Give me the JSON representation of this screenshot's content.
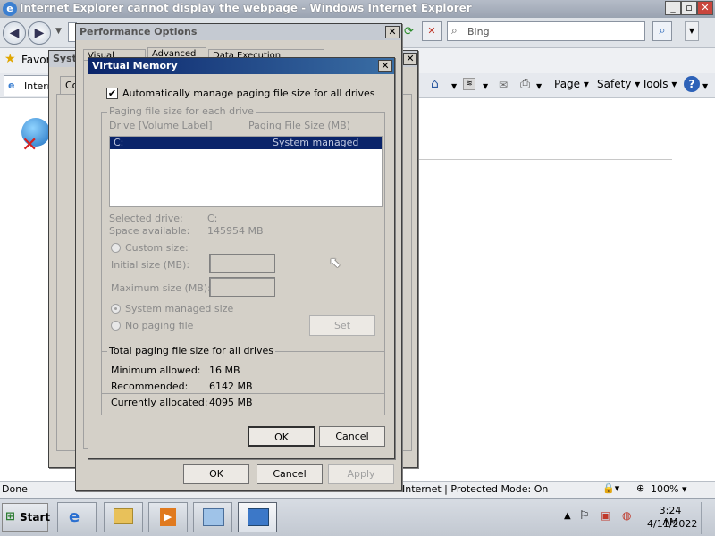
{
  "ie": {
    "title": "Internet Explorer cannot display the webpage - Windows Internet Explorer",
    "search_placeholder": "Bing",
    "favorites_label": "Favori",
    "tab_label": "Intern",
    "commands": [
      "Page",
      "Safety",
      "Tools"
    ],
    "status_left": "Done",
    "status_zone": "Internet | Protected Mode: On",
    "zoom": "100%"
  },
  "background_dialogs": {
    "system_label": "Syst",
    "sysprops_tab": "Co"
  },
  "perf": {
    "title": "Performance Options",
    "tabs": [
      "Visual Effects",
      "Advanced",
      "Data Execution Prevention"
    ],
    "ok": "OK",
    "cancel": "Cancel",
    "apply": "Apply"
  },
  "vm": {
    "title": "Virtual Memory",
    "auto_manage_label": "Automatically manage paging file size for all drives",
    "auto_manage_checked": true,
    "each_drive_group": "Paging file size for each drive",
    "col_drive": "Drive  [Volume Label]",
    "col_size": "Paging File Size (MB)",
    "drives": [
      {
        "drive": "C:",
        "size": "System managed"
      }
    ],
    "selected_drive_label": "Selected drive:",
    "selected_drive_value": "C:",
    "space_available_label": "Space available:",
    "space_available_value": "145954 MB",
    "custom_size_label": "Custom size:",
    "initial_size_label": "Initial size (MB):",
    "maximum_size_label": "Maximum size (MB):",
    "system_managed_label": "System managed size",
    "no_paging_label": "No paging file",
    "set_button": "Set",
    "total_group": "Total paging file size for all drives",
    "minimum_label": "Minimum allowed:",
    "minimum_value": "16 MB",
    "recommended_label": "Recommended:",
    "recommended_value": "6142 MB",
    "allocated_label": "Currently allocated:",
    "allocated_value": "4095 MB",
    "ok": "OK",
    "cancel": "Cancel"
  },
  "taskbar": {
    "start": "Start",
    "time": "3:24 AM",
    "date": "4/11/2022"
  }
}
